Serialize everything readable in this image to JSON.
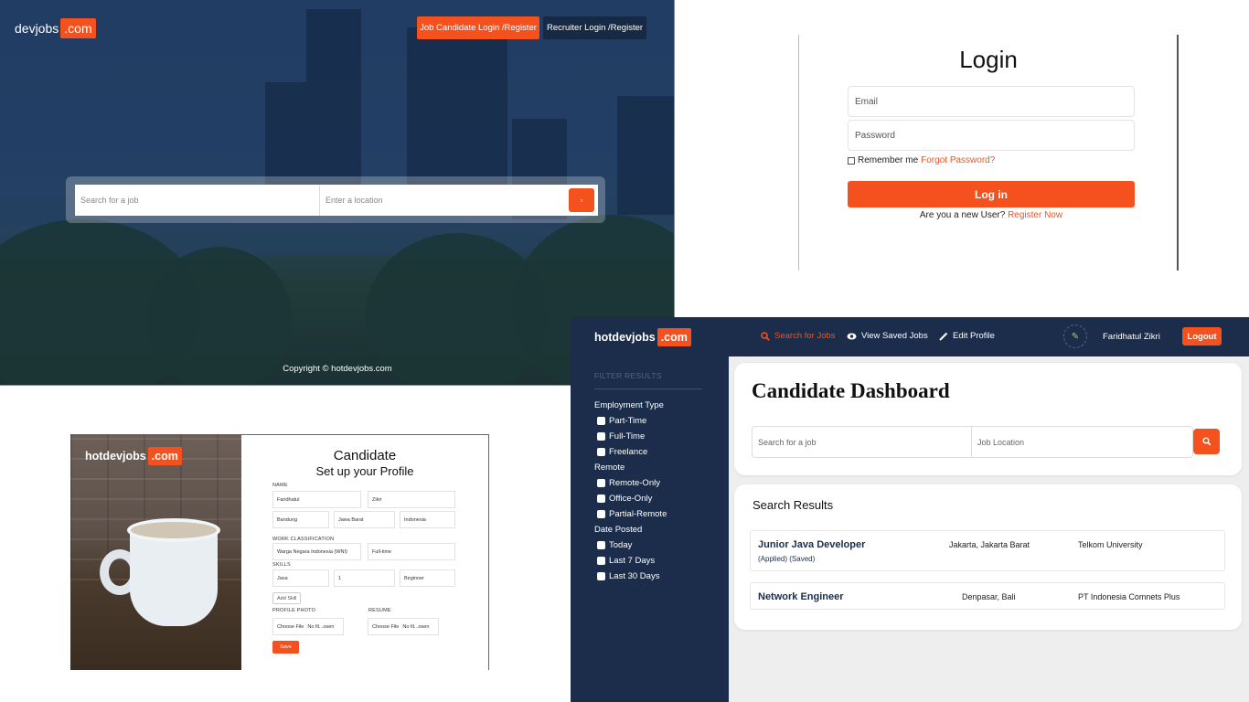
{
  "landing": {
    "brand_name": "devjobs",
    "brand_suffix": ".com",
    "candidate_btn": "Job Candidate Login /Register",
    "recruiter_btn": "Recruiter Login /Register",
    "search_placeholder": "Search for a job",
    "location_placeholder": "Enter a location",
    "search_btn_icon": "search-icon",
    "copyright": "Copyright © hotdevjobs.com"
  },
  "login": {
    "title": "Login",
    "email_placeholder": "Email",
    "password_placeholder": "Password",
    "remember_label": "Remember me",
    "forgot_link": "Forgot Password?",
    "login_btn": "Log in",
    "new_user_text": "Are you a new User?",
    "register_link": "Register Now"
  },
  "profile": {
    "brand_name": "hotdevjobs",
    "brand_suffix": ".com",
    "title": "Candidate",
    "subtitle": "Set up your Profile",
    "name_label": "NAME",
    "first_name": "Faridhatul",
    "last_name": "Zikri",
    "city": "Bandung",
    "province": "Jawa Barat",
    "country": "Indonesia",
    "work_label": "WORK CLASSIFICATION",
    "work_auth": "Warga Negara Indonesia (WNI)",
    "work_type": "Full-time",
    "skills_label": "SKILLS",
    "skill_name": "Java",
    "skill_years": "1",
    "skill_level": "Beginner",
    "add_skill": "Add Skill",
    "photo_label": "PROFILE PHOTO",
    "resume_label": "RESUME",
    "choose_file": "Choose File",
    "no_file": "No fil...osen",
    "save": "Save"
  },
  "dashboard": {
    "brand_name": "hotdevjobs",
    "brand_suffix": ".com",
    "nav": {
      "search": "Search for Jobs",
      "saved": "View Saved Jobs",
      "edit": "Edit Profile"
    },
    "user_name": "Faridhatul Zikri",
    "logout": "Logout",
    "filter_title": "FILTER RESULTS",
    "employment_head": "Employment Type",
    "employment_opts": [
      "Part-Time",
      "Full-Time",
      "Freelance"
    ],
    "remote_head": "Remote",
    "remote_opts": [
      "Remote-Only",
      "Office-Only",
      "Partial-Remote"
    ],
    "date_head": "Date Posted",
    "date_opts": [
      "Today",
      "Last 7 Days",
      "Last 30 Days"
    ],
    "title": "Candidate Dashboard",
    "search_placeholder": "Search for a job",
    "location_placeholder": "Job Location",
    "results_title": "Search Results",
    "results": [
      {
        "title": "Junior Java Developer",
        "status": "(Applied)  (Saved)",
        "location": "Jakarta, Jakarta Barat",
        "company": "Telkom University"
      },
      {
        "title": "Network Engineer",
        "status": "",
        "location": "Denpasar, Bali",
        "company": "PT Indonesia Comnets Plus"
      }
    ]
  }
}
